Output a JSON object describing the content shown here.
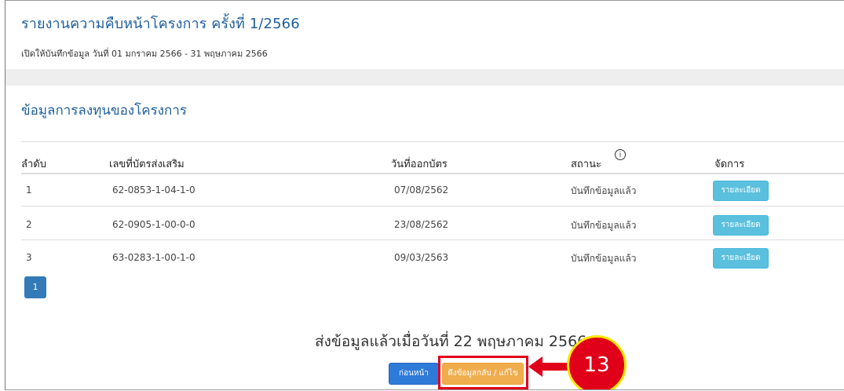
{
  "header": {
    "title": "รายงานความคืบหน้าโครงการ ครั้งที่ 1/2566",
    "period": "เปิดให้บันทึกข้อมูล วันที่ 01 มกราคม 2566 - 31 พฤษภาคม 2566"
  },
  "section": {
    "title": "ข้อมูลการลงทุนของโครงการ"
  },
  "table": {
    "columns": {
      "no": "ลำดับ",
      "certificate": "เลขที่บัตรส่งเสริม",
      "issue_date": "วันที่ออกบัตร",
      "status": "สถานะ",
      "manage": "จัดการ"
    },
    "status_info_icon": "info-circle-icon",
    "rows": [
      {
        "no": "1",
        "certificate": "62-0853-1-04-1-0",
        "issue_date": "07/08/2562",
        "status": "บันทึกข้อมูลแล้ว",
        "action": "รายละเอียด"
      },
      {
        "no": "2",
        "certificate": "62-0905-1-00-0-0",
        "issue_date": "23/08/2562",
        "status": "บันทึกข้อมูลแล้ว",
        "action": "รายละเอียด"
      },
      {
        "no": "3",
        "certificate": "63-0283-1-00-1-0",
        "issue_date": "09/03/2563",
        "status": "บันทึกข้อมูลแล้ว",
        "action": "รายละเอียด"
      }
    ]
  },
  "pagination": {
    "current_page": "1"
  },
  "footer": {
    "submitted_text": "ส่งข้อมูลแล้วเมื่อวันที่ 22 พฤษภาคม 2566",
    "back_label": "ก่อนหน้า",
    "pull_back_label": "ดึงข้อมูลกลับ / แก้ไข"
  },
  "callout": {
    "step_number": "13"
  },
  "colors": {
    "title_blue": "#1f5f9c",
    "info_button": "#5bc0de",
    "primary_button": "#2e7ad9",
    "warning_button": "#f0ad4e",
    "callout_red": "#e0001a",
    "callout_ring": "#ffe600"
  }
}
